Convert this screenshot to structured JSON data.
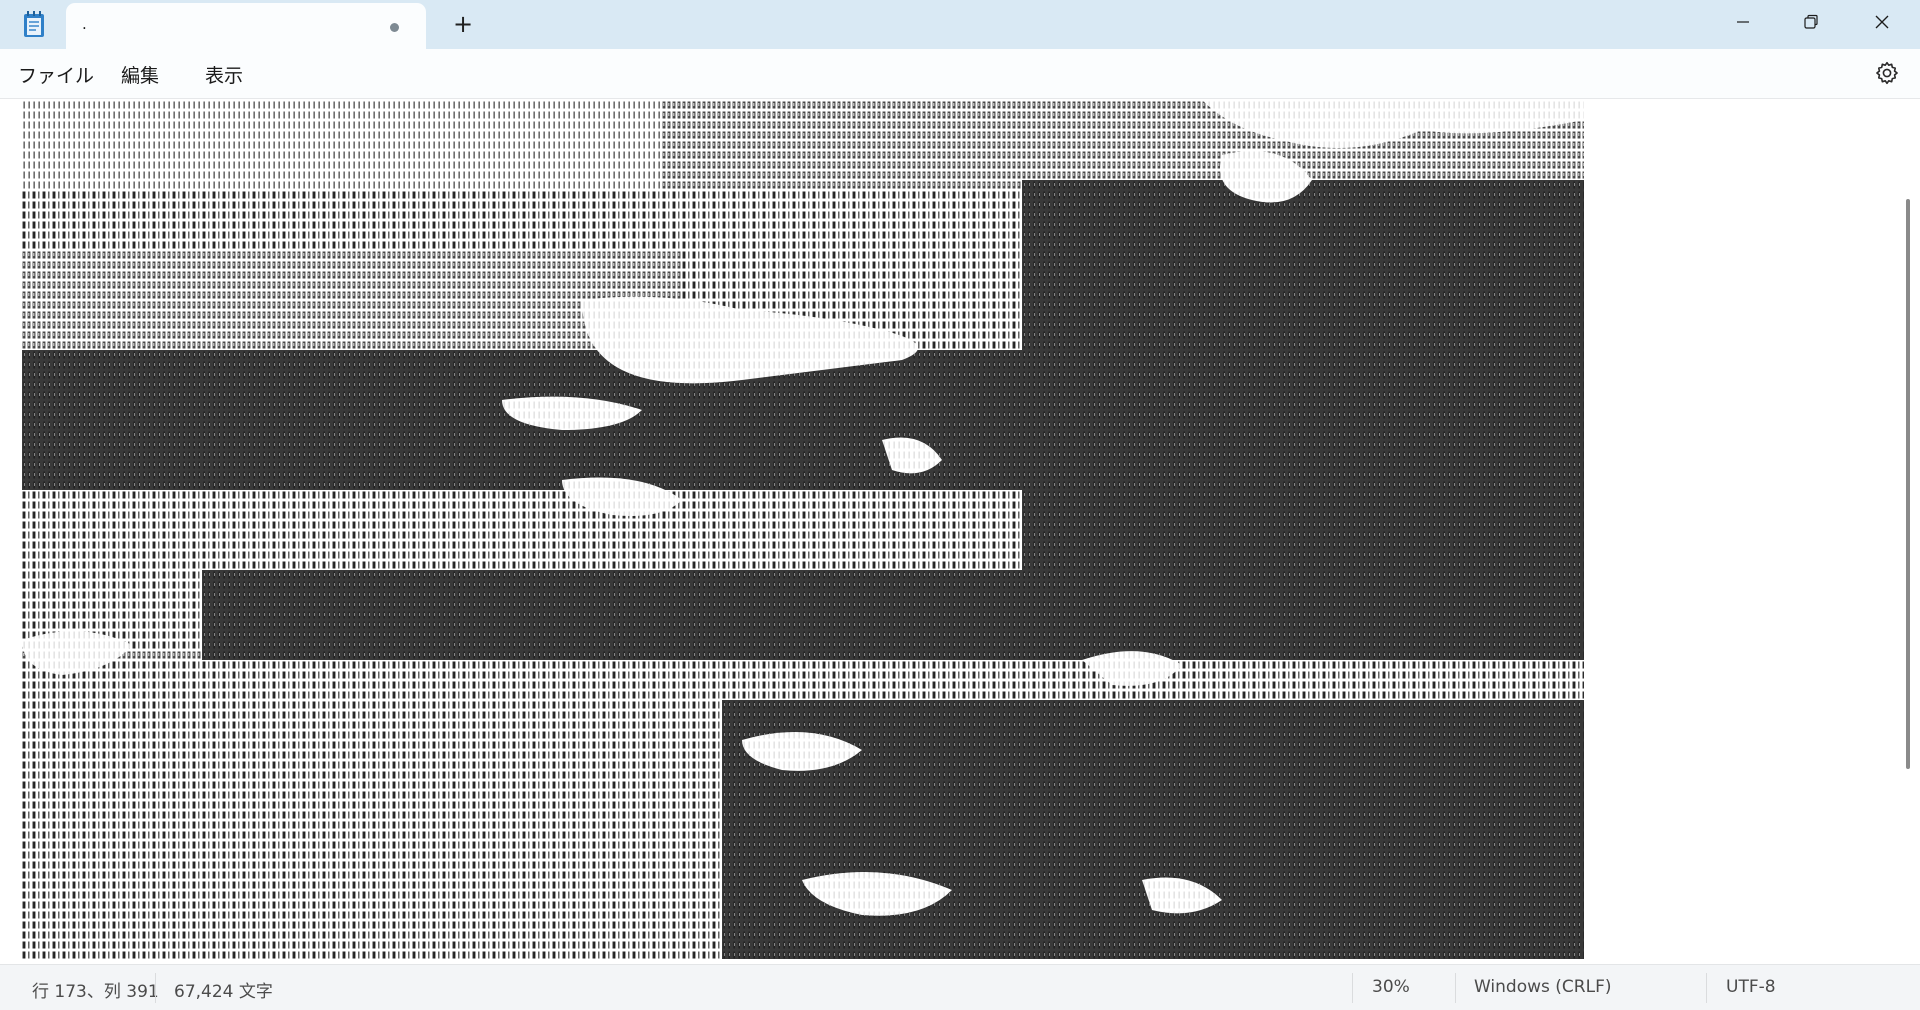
{
  "window": {
    "tab_title": "."
  },
  "menu": {
    "file": "ファイル",
    "edit": "編集",
    "view": "表示"
  },
  "icons": {
    "app": "notepad-icon",
    "new_tab": "plus-icon",
    "minimize": "minimize-icon",
    "maximize": "restore-icon",
    "close": "close-icon",
    "settings": "gear-icon",
    "unsaved": "unsaved-dot-icon"
  },
  "status": {
    "position": "行 173、列 391",
    "char_count": "67,424 文字",
    "zoom": "30%",
    "line_ending": "Windows (CRLF)",
    "encoding": "UTF-8"
  },
  "new_tab_glyph": "+"
}
